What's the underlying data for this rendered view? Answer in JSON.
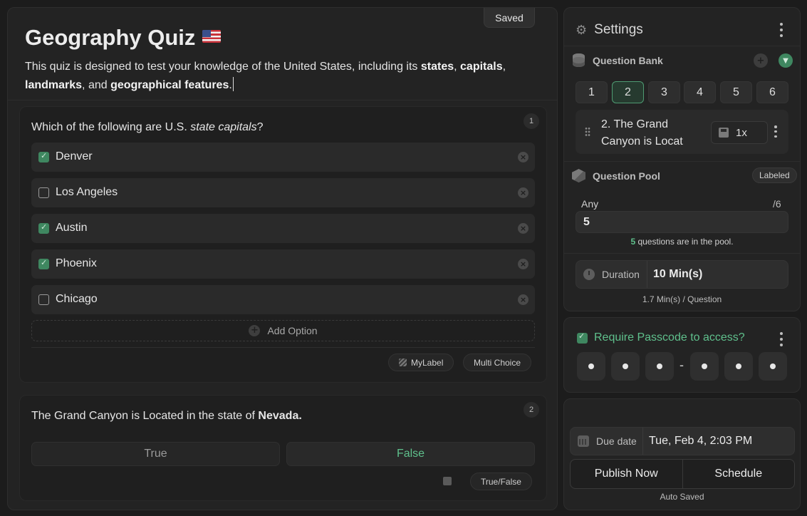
{
  "quiz": {
    "saved_label": "Saved",
    "title": "Geography Quiz",
    "flag": "us-flag",
    "description": {
      "p1": "This quiz is designed to test your knowledge of the United States, including its ",
      "b1": "states",
      "p2": ", ",
      "b2": "capitals",
      "p3": ", ",
      "b3": "landmarks",
      "p4": ", and ",
      "b4": "geographical features",
      "p5": "."
    }
  },
  "questions": [
    {
      "number": "1",
      "text_pre": "Which of the following are U.S. ",
      "text_em": "state capitals",
      "text_post": "?",
      "options": [
        {
          "label": "Denver",
          "checked": true
        },
        {
          "label": "Los Angeles",
          "checked": false
        },
        {
          "label": "Austin",
          "checked": true
        },
        {
          "label": "Phoenix",
          "checked": true
        },
        {
          "label": "Chicago",
          "checked": false
        }
      ],
      "add_option_label": "Add Option",
      "label_chip": "MyLabel",
      "type_chip": "Multi Choice"
    },
    {
      "number": "2",
      "text_pre": "The Grand Canyon is Located in the state of ",
      "text_bold": "Nevada.",
      "true_label": "True",
      "false_label": "False",
      "selected": "False",
      "type_chip": "True/False"
    }
  ],
  "settings": {
    "title": "Settings",
    "question_bank": {
      "title": "Question Bank",
      "tabs": [
        "1",
        "2",
        "3",
        "4",
        "5",
        "6"
      ],
      "selected_tab": "2",
      "item": {
        "text": "2. The Grand Canyon is Locat",
        "multiplier": "1x"
      }
    },
    "question_pool": {
      "title": "Question Pool",
      "badge": "Labeled",
      "any_label": "Any",
      "of_total": "/6",
      "value": "5",
      "note_count": "5",
      "note_text": " questions are in the pool."
    },
    "duration": {
      "label": "Duration",
      "value": "10 Min(s)",
      "note": "1.7 Min(s) / Question"
    }
  },
  "passcode": {
    "label": "Require Passcode to access?",
    "enabled": true,
    "digits": 6,
    "separator": "-"
  },
  "publish": {
    "due_label": "Due date",
    "due_value": "Tue, Feb 4, 2:03 PM",
    "publish_now": "Publish Now",
    "schedule": "Schedule",
    "auto_saved": "Auto Saved"
  },
  "colors": {
    "accent_green": "#5fc08c",
    "check_green": "#3f8760",
    "background": "#1c1c1c"
  }
}
